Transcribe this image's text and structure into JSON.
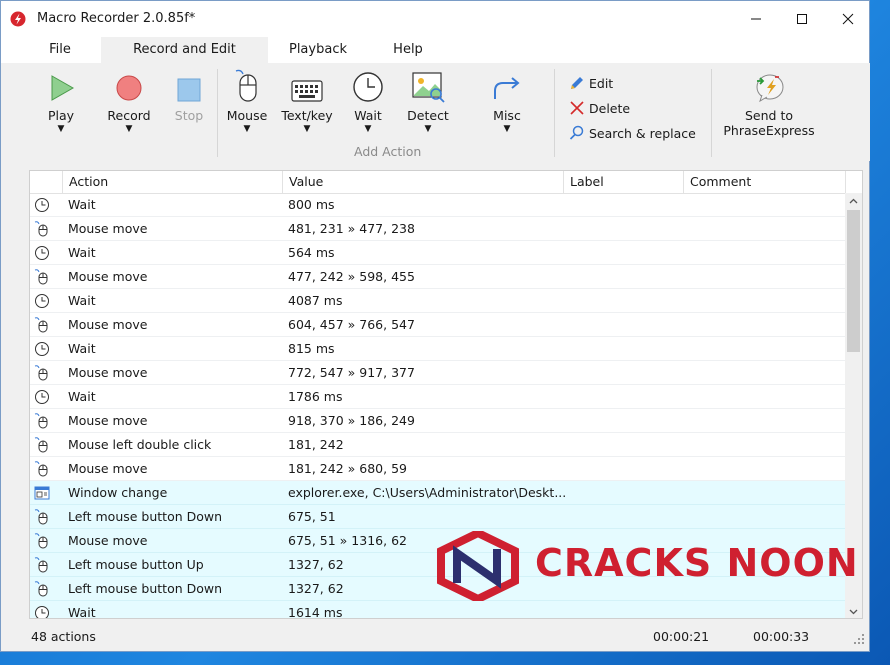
{
  "window": {
    "title": "Macro Recorder 2.0.85f*"
  },
  "menu": {
    "tabs": [
      {
        "label": "File"
      },
      {
        "label": "Record and Edit",
        "active": true
      },
      {
        "label": "Playback"
      },
      {
        "label": "Help"
      }
    ]
  },
  "ribbon": {
    "play": "Play",
    "record": "Record",
    "stop": "Stop",
    "mouse": "Mouse",
    "textkey": "Text/key",
    "wait": "Wait",
    "detect": "Detect",
    "misc": "Misc",
    "add_action_group": "Add Action",
    "edit": "Edit",
    "delete": "Delete",
    "search_replace": "Search & replace",
    "send_to_line1": "Send to",
    "send_to_line2": "PhraseExpress"
  },
  "table": {
    "columns": [
      "Action",
      "Value",
      "Label",
      "Comment"
    ],
    "rows": [
      {
        "icon": "clock-icon",
        "action": "Wait",
        "value": "800 ms",
        "highlight": false
      },
      {
        "icon": "mouse-icon",
        "action": "Mouse move",
        "value": "481, 231 » 477, 238",
        "highlight": false
      },
      {
        "icon": "clock-icon",
        "action": "Wait",
        "value": "564 ms",
        "highlight": false
      },
      {
        "icon": "mouse-icon",
        "action": "Mouse move",
        "value": "477, 242 » 598, 455",
        "highlight": false
      },
      {
        "icon": "clock-icon",
        "action": "Wait",
        "value": "4087 ms",
        "highlight": false
      },
      {
        "icon": "mouse-icon",
        "action": "Mouse move",
        "value": "604, 457 » 766, 547",
        "highlight": false
      },
      {
        "icon": "clock-icon",
        "action": "Wait",
        "value": "815 ms",
        "highlight": false
      },
      {
        "icon": "mouse-icon",
        "action": "Mouse move",
        "value": "772, 547 » 917, 377",
        "highlight": false
      },
      {
        "icon": "clock-icon",
        "action": "Wait",
        "value": "1786 ms",
        "highlight": false
      },
      {
        "icon": "mouse-icon",
        "action": "Mouse move",
        "value": "918, 370 » 186, 249",
        "highlight": false
      },
      {
        "icon": "mouse-icon",
        "action": "Mouse left double click",
        "value": "181, 242",
        "highlight": false
      },
      {
        "icon": "mouse-icon",
        "action": "Mouse move",
        "value": "181, 242 » 680, 59",
        "highlight": false
      },
      {
        "icon": "window-icon",
        "action": "Window change",
        "value": "explorer.exe, C:\\Users\\Administrator\\Deskt...",
        "highlight": true
      },
      {
        "icon": "mouse-icon",
        "action": "Left mouse button Down",
        "value": "675, 51",
        "highlight": true
      },
      {
        "icon": "mouse-icon",
        "action": "Mouse move",
        "value": "675, 51 » 1316, 62",
        "highlight": true
      },
      {
        "icon": "mouse-icon",
        "action": "Left mouse button Up",
        "value": "1327, 62",
        "highlight": true
      },
      {
        "icon": "mouse-icon",
        "action": "Left mouse button Down",
        "value": "1327, 62",
        "highlight": true
      },
      {
        "icon": "clock-icon",
        "action": "Wait",
        "value": "1614 ms",
        "highlight": true
      }
    ]
  },
  "status": {
    "count": "48 actions",
    "time1": "00:00:21",
    "time2": "00:00:33"
  },
  "watermark": {
    "text": "CRACKS NOON"
  },
  "colors": {
    "highlight_row": "#e5fbff",
    "watermark": "#cf2030",
    "accent_blue": "#2f7ad8"
  }
}
